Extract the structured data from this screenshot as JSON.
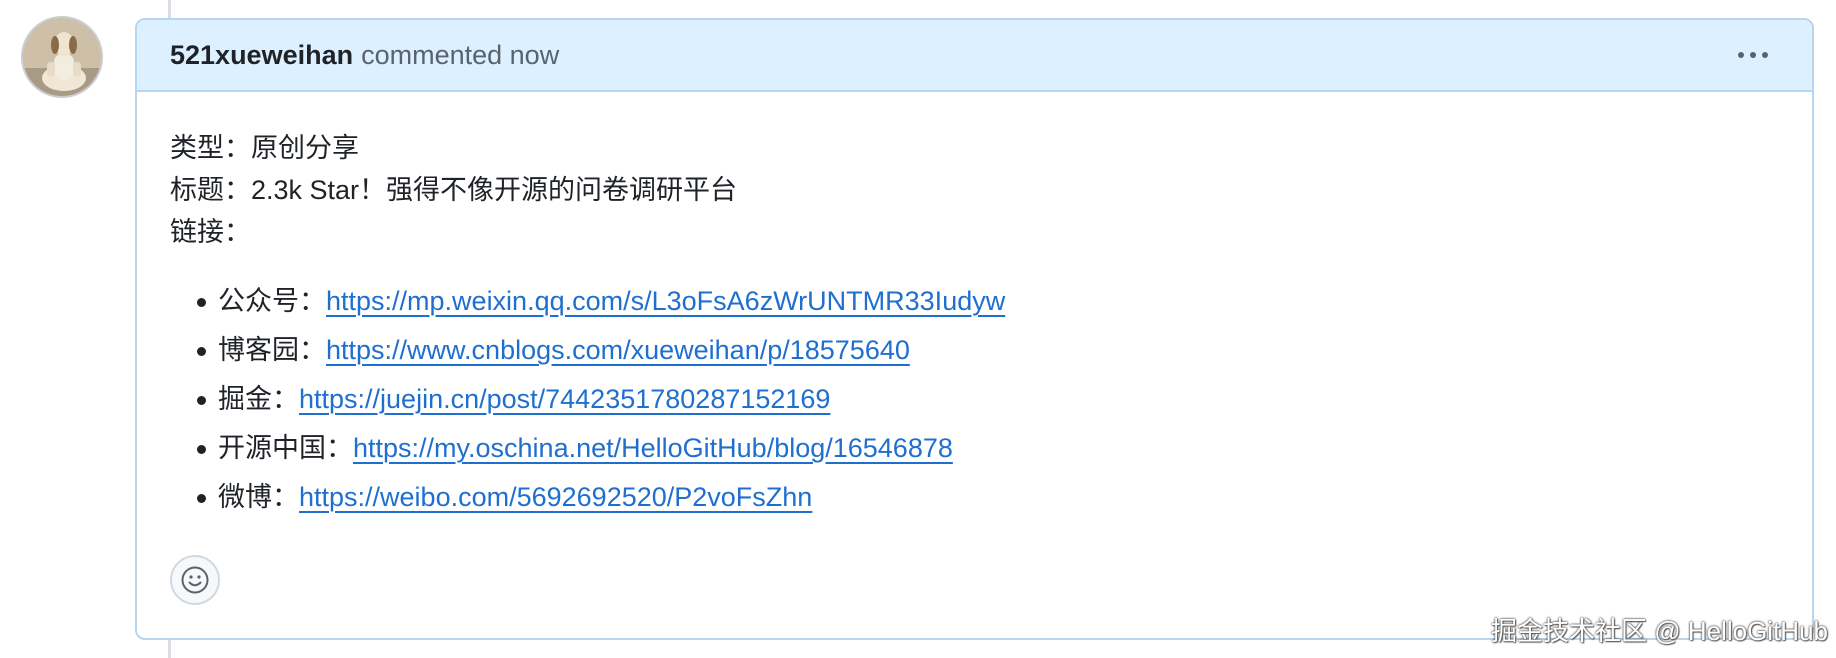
{
  "comment": {
    "author": "521xueweihan",
    "meta": "commented now",
    "lines": [
      "类型：原创分享",
      "标题：2.3k Star！强得不像开源的问卷调研平台",
      "链接："
    ],
    "links": [
      {
        "label": "公众号：",
        "url": "https://mp.weixin.qq.com/s/L3oFsA6zWrUNTMR33Iudyw"
      },
      {
        "label": "博客园：",
        "url": "https://www.cnblogs.com/xueweihan/p/18575640"
      },
      {
        "label": "掘金：",
        "url": "https://juejin.cn/post/7442351780287152169"
      },
      {
        "label": "开源中国：",
        "url": "https://my.oschina.net/HelloGitHub/blog/16546878"
      },
      {
        "label": "微博：",
        "url": "https://weibo.com/5692692520/P2voFsZhn"
      }
    ]
  },
  "icons": {
    "avatar": "avatar-dog-meditating",
    "menu": "kebab-horizontal-icon",
    "reaction": "smiley-icon"
  },
  "watermark": "掘金技术社区 @ HelloGitHub",
  "colors": {
    "header_bg": "#ddf0ff",
    "border": "#b6d6f1",
    "link": "#1f6fd0"
  }
}
